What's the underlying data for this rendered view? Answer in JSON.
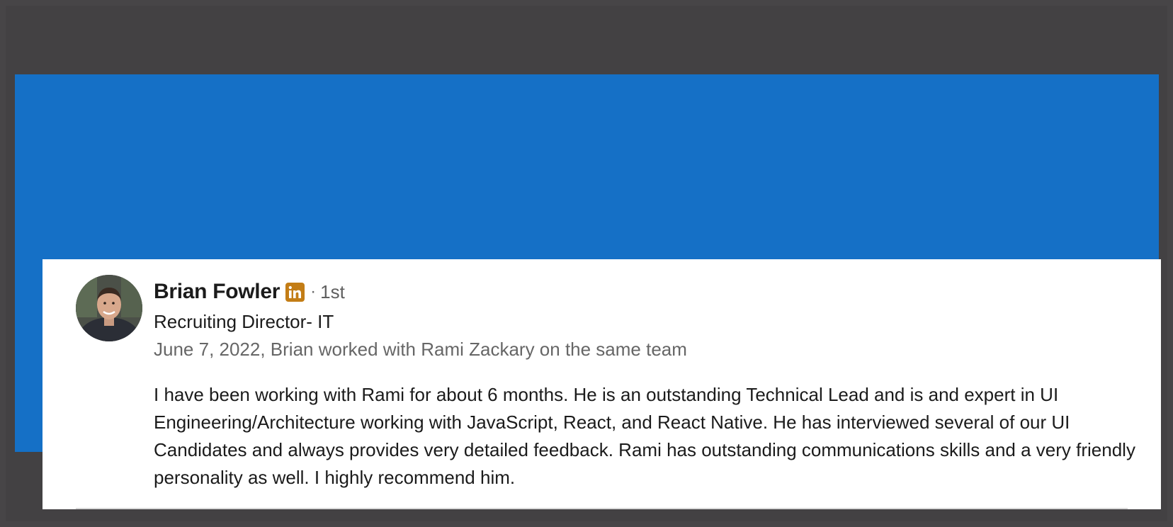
{
  "recommendation": {
    "name": "Brian Fowler",
    "badge_icon": "linkedin-icon",
    "badge_color": "#c37d16",
    "separator": "·",
    "connection_degree": "1st",
    "headline": "Recruiting Director- IT",
    "relationship": "June 7, 2022, Brian worked with Rami Zackary on the same team",
    "text": "I have been working with Rami for about 6 months. He is an outstanding Technical Lead and is and expert in UI Engineering/Architecture working with JavaScript, React, and React Native. He has interviewed several of our UI Candidates and always provides very detailed feedback. Rami has outstanding communications skills and a very friendly personality as well. I highly recommend him."
  },
  "colors": {
    "banner": "#1570c6",
    "background": "#474547",
    "card": "#ffffff"
  }
}
